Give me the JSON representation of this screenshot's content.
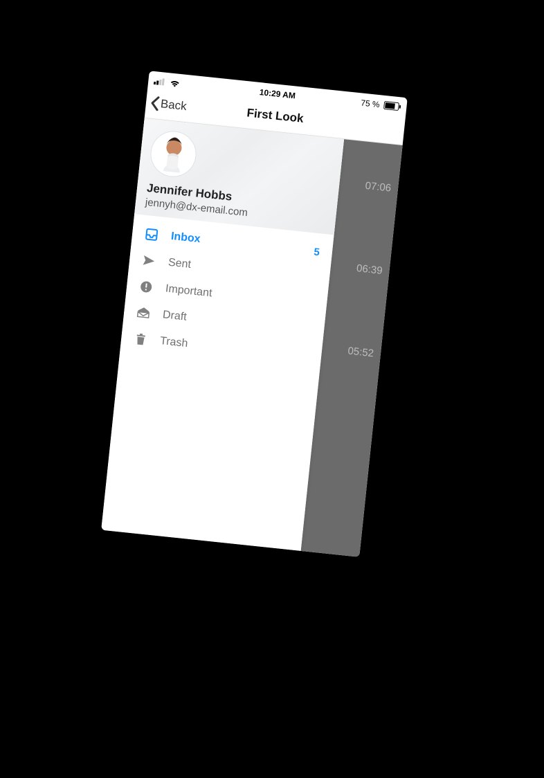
{
  "status": {
    "time": "10:29 AM",
    "battery_text": "75 %"
  },
  "nav": {
    "back_label": "Back",
    "title": "First Look"
  },
  "profile": {
    "name": "Jennifer Hobbs",
    "email": "jennyh@dx-email.com"
  },
  "folders": [
    {
      "icon": "inbox",
      "label": "Inbox",
      "count": "5",
      "active": true
    },
    {
      "icon": "sent",
      "label": "Sent",
      "count": "",
      "active": false
    },
    {
      "icon": "important",
      "label": "Important",
      "count": "",
      "active": false
    },
    {
      "icon": "draft",
      "label": "Draft",
      "count": "",
      "active": false
    },
    {
      "icon": "trash",
      "label": "Trash",
      "count": "",
      "active": false
    }
  ],
  "background_times": [
    "07:06",
    "06:39",
    "05:52"
  ],
  "colors": {
    "accent": "#148eff"
  }
}
